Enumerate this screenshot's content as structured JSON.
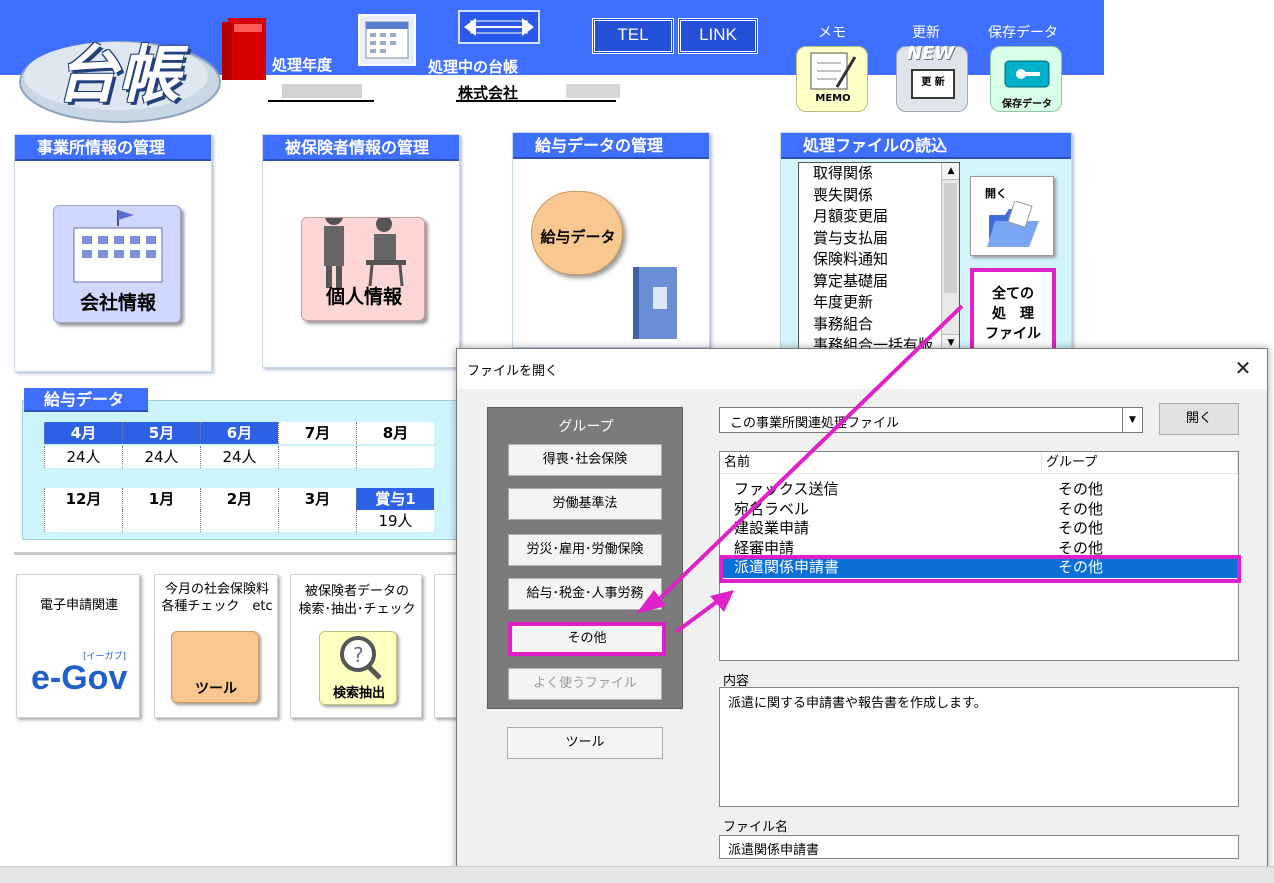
{
  "header": {
    "logo_text": "台帳",
    "fiscal_year_label": "処理年度",
    "current_ledger_label": "処理中の台帳",
    "company_name": "株式会社",
    "tel_label": "TEL",
    "link_label": "LINK",
    "memo_label": "メモ",
    "memo_icon_text": "MEMO",
    "update_label": "更新",
    "update_icon_text": "更 新",
    "new_badge": "NEW",
    "save_label": "保存データ",
    "save_icon_text": "保存データ"
  },
  "panels": {
    "office": {
      "title": "事業所情報の管理",
      "button": "会社情報"
    },
    "insured": {
      "title": "被保険者情報の管理",
      "button": "個人情報"
    },
    "salary": {
      "title": "給与データの管理",
      "button": "給与データ"
    },
    "files": {
      "title": "処理ファイルの読込",
      "items": [
        "取得関係",
        "喪失関係",
        "月額変更届",
        "賞与支払届",
        "保険料通知",
        "算定基礎届",
        "年度更新",
        "事務組合",
        "事務組合一括有版"
      ],
      "open_label": "開く",
      "all_files_label_1": "全ての",
      "all_files_label_2": "処　理",
      "all_files_label_3": "ファイル"
    }
  },
  "salary_table": {
    "title": "給与データ",
    "row1_months": [
      "4月",
      "5月",
      "6月",
      "7月",
      "8月"
    ],
    "row1_values": [
      "24人",
      "24人",
      "24人",
      "",
      ""
    ],
    "row2_months": [
      "12月",
      "1月",
      "2月",
      "3月",
      "賞与1"
    ],
    "row2_values": [
      "",
      "",
      "",
      "",
      "19人"
    ]
  },
  "bottom": {
    "egov_title": "電子申請関連",
    "egov_logo": "e-Gov",
    "egov_sub": "[イーガブ]",
    "check_title_1": "今月の社会保険料",
    "check_title_2": "各種チェック　etc",
    "check_button": "ツール",
    "search_title_1": "被保険者データの",
    "search_title_2": "検索･抽出･チェック",
    "search_button": "検索抽出"
  },
  "dialog": {
    "title": "ファイルを開く",
    "group_title": "グループ",
    "groups": [
      "得喪･社会保険",
      "労働基準法",
      "労災･雇用･労働保険",
      "給与･税金･人事労務",
      "その他",
      "よく使うファイル"
    ],
    "tool_button": "ツール",
    "combo_value": "この事業所関連処理ファイル",
    "open_button": "開く",
    "col_name": "名前",
    "col_group": "グループ",
    "rows": [
      {
        "name": "ファックス送信",
        "group": "その他"
      },
      {
        "name": "宛名ラベル",
        "group": "その他"
      },
      {
        "name": "建設業申請",
        "group": "その他"
      },
      {
        "name": "経審申請",
        "group": "その他"
      },
      {
        "name": "派遣関係申請書",
        "group": "その他"
      }
    ],
    "content_label": "内容",
    "content_text": "派遣に関する申請書や報告書を作成します。",
    "filename_label": "ファイル名",
    "filename_value": "派遣関係申請書"
  },
  "colors": {
    "banner": "#3f6fff",
    "highlight": "#e020c8",
    "selection": "#0a6fd6"
  }
}
